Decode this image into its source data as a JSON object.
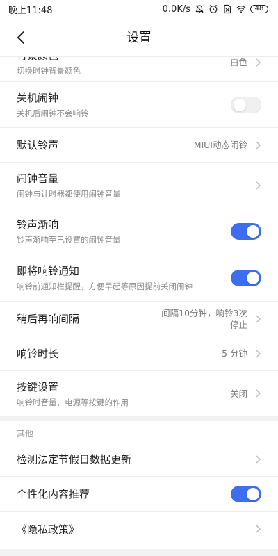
{
  "status": {
    "time": "晚上11:48",
    "net_speed": "0.0K/s",
    "battery": "48"
  },
  "header": {
    "title": "设置"
  },
  "rows": {
    "bg_color": {
      "title": "背景颜色",
      "subtitle": "切换时钟背景颜色",
      "value": "白色"
    },
    "shutdown_alarm": {
      "title": "关机闹钟",
      "subtitle": "关机后闹钟不会响铃",
      "toggle": false
    },
    "default_ringtone": {
      "title": "默认铃声",
      "value": "MIUI动态闹铃"
    },
    "alarm_volume": {
      "title": "闹钟音量",
      "subtitle": "闹钟与计时器都使用闹钟音量"
    },
    "fade_in": {
      "title": "铃声渐响",
      "subtitle": "铃声渐响至已设置的闹钟音量",
      "toggle": true
    },
    "upcoming_notice": {
      "title": "即将响铃通知",
      "subtitle": "响铃前通知栏提醒，方便早起等原因提前关闭闹钟",
      "toggle": true
    },
    "snooze_interval": {
      "title": "稍后再响间隔",
      "value_line1": "间隔10分钟，响铃3次",
      "value_line2": "停止"
    },
    "ring_duration": {
      "title": "响铃时长",
      "value": "5 分钟"
    },
    "button_settings": {
      "title": "按键设置",
      "subtitle": "响铃时音量、电源等按键的作用",
      "value": "关闭"
    }
  },
  "other_section": {
    "label": "其他",
    "holiday_update": {
      "title": "检测法定节假日数据更新"
    },
    "personalized": {
      "title": "个性化内容推荐",
      "toggle": true
    },
    "privacy": {
      "title": "《隐私政策》"
    }
  }
}
